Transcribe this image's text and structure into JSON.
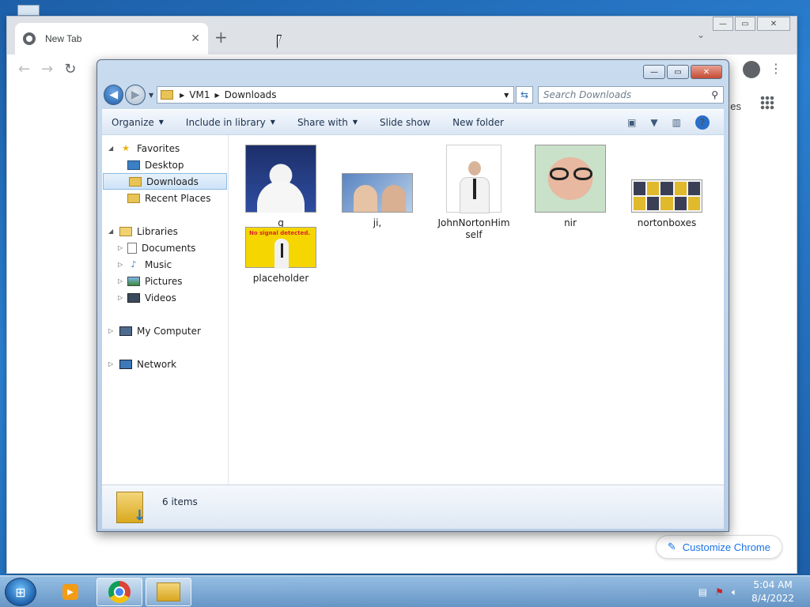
{
  "chrome": {
    "tab_title": "New Tab",
    "tab_close": "✕",
    "new_tab": "+",
    "tab_search": "⌄",
    "back": "←",
    "forward": "→",
    "reload": "↻",
    "menu": "⋮",
    "apps_label_partial": "es",
    "customize_label": "Customize Chrome",
    "window_controls": {
      "minimize": "—",
      "maximize": "▭",
      "close": "✕"
    }
  },
  "explorer": {
    "caption": {
      "minimize": "—",
      "maximize": "▭",
      "close": "✕"
    },
    "breadcrumb": [
      "VM1",
      "Downloads"
    ],
    "search_placeholder": "Search Downloads",
    "commands": {
      "organize": "Organize",
      "include_in_library": "Include in library",
      "share_with": "Share with",
      "slide_show": "Slide show",
      "new_folder": "New folder"
    },
    "help_label": "?",
    "nav": {
      "favorites": "Favorites",
      "desktop": "Desktop",
      "downloads": "Downloads",
      "recent_places": "Recent Places",
      "libraries": "Libraries",
      "documents": "Documents",
      "music": "Music",
      "pictures": "Pictures",
      "videos": "Videos",
      "my_computer": "My Computer",
      "network": "Network"
    },
    "files": {
      "g": "g",
      "ji": "ji,",
      "john": "JohnNortonHimself",
      "nir": "nir",
      "nortonboxes": "nortonboxes",
      "placeholder": "placeholder"
    },
    "placeholder_text": "No signal detected.",
    "item_count": "6 items"
  },
  "taskbar": {
    "time": "5:04 AM",
    "date": "8/4/2022"
  },
  "colors": {
    "chrome_accent": "#1a73e8",
    "explorer_selection": "#cde3f8",
    "close_red": "#c44b33"
  }
}
